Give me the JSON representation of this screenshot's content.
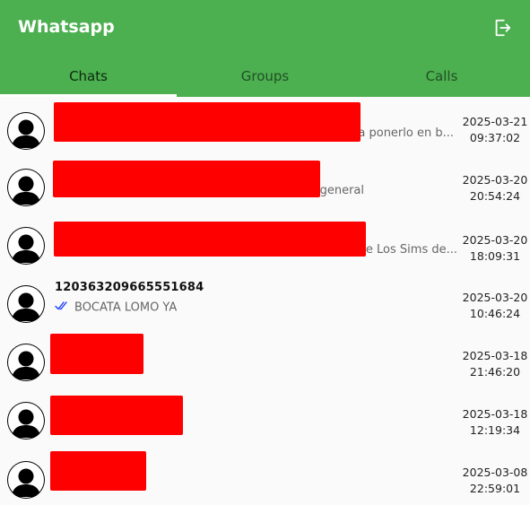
{
  "app": {
    "title": "Whatsapp",
    "accent": "#4caf50"
  },
  "tabs": [
    {
      "label": "Chats",
      "active": true
    },
    {
      "label": "Groups",
      "active": false
    },
    {
      "label": "Calls",
      "active": false
    }
  ],
  "chats": [
    {
      "name": "",
      "message": "a ponerlo en b...",
      "date": "2025-03-21",
      "time": "09:37:02"
    },
    {
      "name": "",
      "message": "general",
      "date": "2025-03-20",
      "time": "20:54:24"
    },
    {
      "name": "",
      "message": "de Los Sims de...",
      "date": "2025-03-20",
      "time": "18:09:31"
    },
    {
      "name": "120363209665551684",
      "message": "BOCATA LOMO YA",
      "date": "2025-03-20",
      "time": "10:46:24"
    },
    {
      "name": "",
      "message": "",
      "date": "2025-03-18",
      "time": "21:46:20"
    },
    {
      "name": "",
      "message": "",
      "date": "2025-03-18",
      "time": "12:19:34"
    },
    {
      "name": "",
      "message": "",
      "date": "2025-03-08",
      "time": "22:59:01"
    }
  ],
  "icons": {
    "logout": "logout-icon",
    "avatar": "avatar-icon",
    "read": "double-check-icon"
  },
  "colors": {
    "redaction": "#ff0000",
    "read_check": "#1a3cff"
  }
}
